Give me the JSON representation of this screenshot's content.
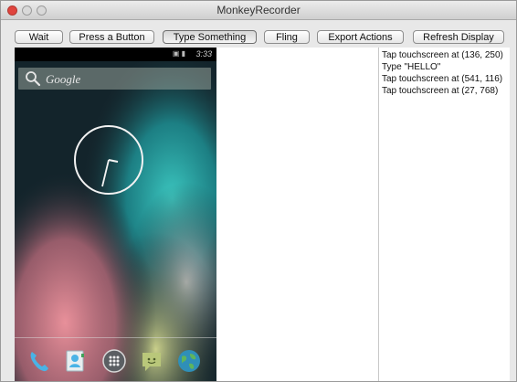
{
  "window": {
    "title": "MonkeyRecorder"
  },
  "toolbar": {
    "buttons": [
      {
        "label": "Wait"
      },
      {
        "label": "Press a Button"
      },
      {
        "label": "Type Something"
      },
      {
        "label": "Fling"
      },
      {
        "label": "Export Actions"
      },
      {
        "label": "Refresh Display"
      }
    ]
  },
  "device": {
    "status_time": "3:33",
    "status_icons": "▣ ▮",
    "search_label": "Google",
    "dock": [
      {
        "icon": "phone-icon"
      },
      {
        "icon": "contacts-icon"
      },
      {
        "icon": "app-drawer-icon"
      },
      {
        "icon": "messaging-icon"
      },
      {
        "icon": "browser-icon"
      }
    ]
  },
  "action_log": [
    "Tap touchscreen at (136, 250)",
    "Type \"HELLO\"",
    "Tap touchscreen at (541, 116)",
    "Tap touchscreen at (27, 768)"
  ],
  "colors": {
    "close_button": "#e0443e",
    "wallpaper_teal": "#1f9a9a",
    "wallpaper_pink": "#d97a86"
  }
}
